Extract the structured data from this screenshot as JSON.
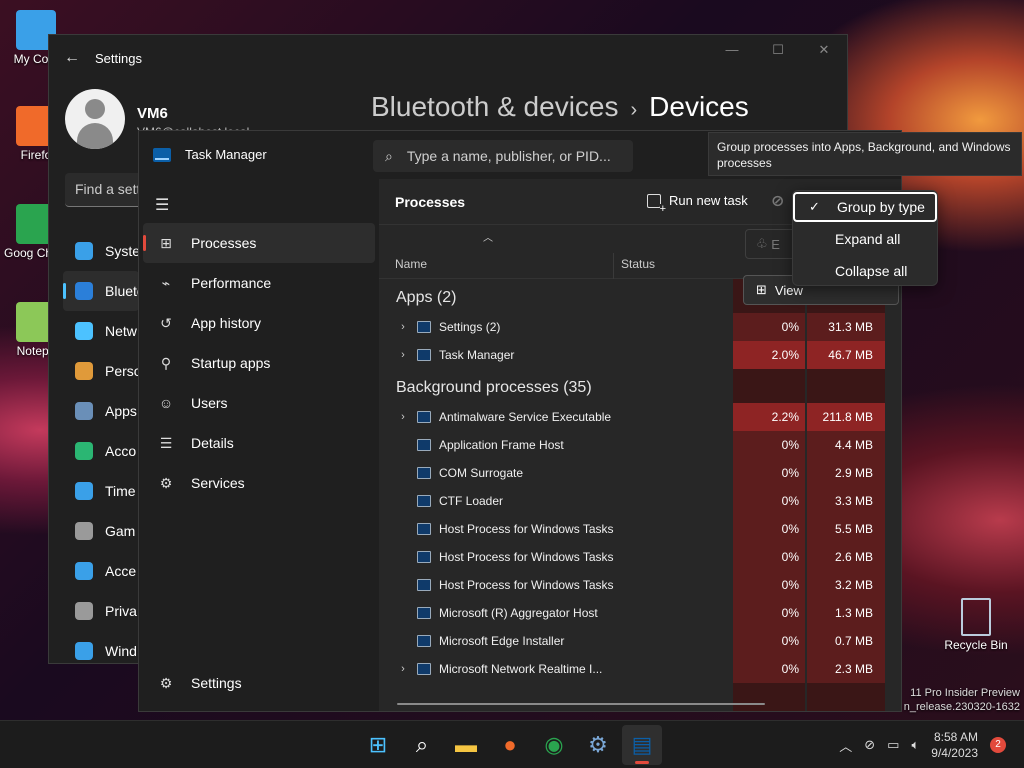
{
  "desktop": {
    "icons": [
      {
        "label": "My Com",
        "icon": "monitor-icon",
        "color": "#3aa0e8"
      },
      {
        "label": "Firefo",
        "icon": "firefox-icon",
        "color": "#f06a2a"
      },
      {
        "label": "Goog Chron",
        "icon": "chrome-icon",
        "color": "#2aa44f"
      },
      {
        "label": "Notepa",
        "icon": "notepad-icon",
        "color": "#8cc858"
      }
    ],
    "recycle_bin": "Recycle Bin",
    "watermark_line1": "11 Pro Insider Preview",
    "watermark_line2": "n_release.230320-1632"
  },
  "settings": {
    "title": "Settings",
    "user_name": "VM6",
    "user_email": "VM6@callahost.local",
    "breadcrumb_parent": "Bluetooth & devices",
    "breadcrumb_sep": "›",
    "breadcrumb_current": "Devices",
    "search_placeholder": "Find a sett",
    "nav": [
      {
        "label": "Syste",
        "icon": "system-icon",
        "color": "#3aa0e8"
      },
      {
        "label": "Blueto",
        "icon": "bluetooth-icon",
        "color": "#2b7fd9"
      },
      {
        "label": "Netw",
        "icon": "wifi-icon",
        "color": "#4cc2ff"
      },
      {
        "label": "Perso",
        "icon": "brush-icon",
        "color": "#e09a3a"
      },
      {
        "label": "Apps",
        "icon": "apps-icon",
        "color": "#6a8fb8"
      },
      {
        "label": "Acco",
        "icon": "account-icon",
        "color": "#2bb673"
      },
      {
        "label": "Time",
        "icon": "clock-icon",
        "color": "#3aa0e8"
      },
      {
        "label": "Gam",
        "icon": "gamepad-icon",
        "color": "#9a9a9a"
      },
      {
        "label": "Acce",
        "icon": "accessibility-icon",
        "color": "#3aa0e8"
      },
      {
        "label": "Priva",
        "icon": "shield-icon",
        "color": "#9a9a9a"
      },
      {
        "label": "Wind",
        "icon": "update-icon",
        "color": "#3aa0e8"
      }
    ]
  },
  "taskmanager": {
    "title": "Task Manager",
    "search_placeholder": "Type a name, publisher, or PID...",
    "nav": [
      {
        "label": "Processes",
        "icon": "processes-icon",
        "glyph": "⊞"
      },
      {
        "label": "Performance",
        "icon": "performance-icon",
        "glyph": "⌁"
      },
      {
        "label": "App history",
        "icon": "history-icon",
        "glyph": "↺"
      },
      {
        "label": "Startup apps",
        "icon": "startup-icon",
        "glyph": "⚲"
      },
      {
        "label": "Users",
        "icon": "users-icon",
        "glyph": "☺"
      },
      {
        "label": "Details",
        "icon": "details-icon",
        "glyph": "☰"
      },
      {
        "label": "Services",
        "icon": "services-icon",
        "glyph": "⚙"
      }
    ],
    "settings_label": "Settings",
    "page_title": "Processes",
    "run_new_task": "Run new task",
    "efficiency_label": "E",
    "view_label": "View",
    "columns": {
      "name": "Name",
      "status": "Status"
    },
    "groups": [
      {
        "label": "Apps (2)",
        "rows": [
          {
            "name": "Settings (2)",
            "expandable": true,
            "cpu": "0%",
            "mem": "31.3 MB",
            "heat": "lo"
          },
          {
            "name": "Task Manager",
            "expandable": true,
            "cpu": "2.0%",
            "mem": "46.7 MB",
            "heat": "hi"
          }
        ]
      },
      {
        "label": "Background processes (35)",
        "rows": [
          {
            "name": "Antimalware Service Executable",
            "expandable": true,
            "cpu": "2.2%",
            "mem": "211.8 MB",
            "heat": "hi"
          },
          {
            "name": "Application Frame Host",
            "expandable": false,
            "cpu": "0%",
            "mem": "4.4 MB",
            "heat": "lo"
          },
          {
            "name": "COM Surrogate",
            "expandable": false,
            "cpu": "0%",
            "mem": "2.9 MB",
            "heat": "lo"
          },
          {
            "name": "CTF Loader",
            "expandable": false,
            "cpu": "0%",
            "mem": "3.3 MB",
            "heat": "lo"
          },
          {
            "name": "Host Process for Windows Tasks",
            "expandable": false,
            "cpu": "0%",
            "mem": "5.5 MB",
            "heat": "lo"
          },
          {
            "name": "Host Process for Windows Tasks",
            "expandable": false,
            "cpu": "0%",
            "mem": "2.6 MB",
            "heat": "lo"
          },
          {
            "name": "Host Process for Windows Tasks",
            "expandable": false,
            "cpu": "0%",
            "mem": "3.2 MB",
            "heat": "lo"
          },
          {
            "name": "Microsoft (R) Aggregator Host",
            "expandable": false,
            "cpu": "0%",
            "mem": "1.3 MB",
            "heat": "lo"
          },
          {
            "name": "Microsoft Edge Installer",
            "expandable": false,
            "cpu": "0%",
            "mem": "0.7 MB",
            "heat": "lo"
          },
          {
            "name": "Microsoft Network Realtime I...",
            "expandable": true,
            "cpu": "0%",
            "mem": "2.3 MB",
            "heat": "lo"
          }
        ]
      }
    ]
  },
  "tooltip": "Group processes into Apps, Background, and Windows processes",
  "menu": {
    "items": [
      {
        "label": "Group by type",
        "checked": true
      },
      {
        "label": "Expand all",
        "checked": false
      },
      {
        "label": "Collapse all",
        "checked": false
      }
    ]
  },
  "taskbar": {
    "apps": [
      {
        "name": "start-icon",
        "color": "#4cc2ff"
      },
      {
        "name": "search-icon",
        "color": "#ffffff"
      },
      {
        "name": "file-explorer-icon",
        "color": "#f5c542"
      },
      {
        "name": "firefox-icon",
        "color": "#f06a2a"
      },
      {
        "name": "chrome-icon",
        "color": "#2aa44f"
      },
      {
        "name": "settings-icon",
        "color": "#7aa7d6"
      },
      {
        "name": "task-manager-icon",
        "color": "#0b5fa8"
      }
    ],
    "time": "8:58 AM",
    "date": "9/4/2023",
    "notifications": "2"
  }
}
